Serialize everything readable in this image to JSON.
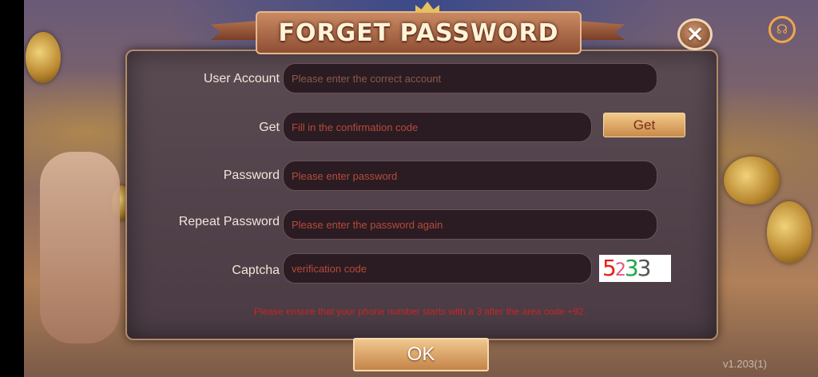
{
  "dialog": {
    "title": "FORGET PASSWORD",
    "close_symbol": "✕"
  },
  "fields": {
    "user_account": {
      "label": "User Account",
      "placeholder": "Please enter the correct account"
    },
    "get_code": {
      "label": "Get",
      "placeholder": "Fill in the confirmation code",
      "button": "Get"
    },
    "password": {
      "label": "Password",
      "placeholder": "Please enter password"
    },
    "repeat_password": {
      "label": "Repeat Password",
      "placeholder": "Please enter the password again"
    },
    "captcha": {
      "label": "Captcha",
      "placeholder": "verification code",
      "chars": [
        "5",
        "2",
        "3",
        "3"
      ]
    }
  },
  "note": "Please ensure that your phone number starts with a 3 after the area code +92.",
  "ok_button": "OK",
  "version": "v1.203(1)",
  "icons": {
    "support": "headset-icon",
    "close": "close-icon"
  },
  "colors": {
    "accent": "#c98a4a",
    "note": "#c72626",
    "placeholder": "#b84a3a"
  }
}
